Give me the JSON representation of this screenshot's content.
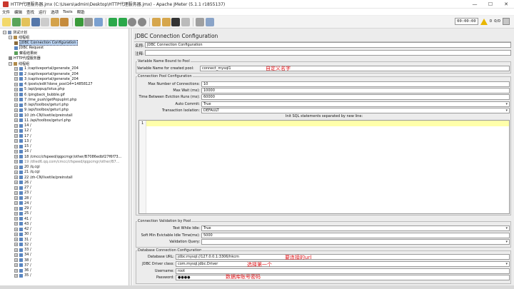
{
  "window": {
    "title": "HTTP代理服务器.jmx (C:\\Users\\admin\\Desktop\\HTTP代理服务器.jmx) - Apache JMeter (5.1.1 r1855137)",
    "min": "—",
    "max": "☐",
    "close": "✕"
  },
  "menu": [
    "文件",
    "编辑",
    "查找",
    "运行",
    "选项",
    "Tools",
    "帮助"
  ],
  "toolbar": {
    "timer": "00:00:00",
    "warnings": "0",
    "threads": "0/0"
  },
  "tree": [
    {
      "label": "测试计划",
      "level": 0,
      "icon": "test-plan-icon",
      "toggle": "−"
    },
    {
      "label": "线程组",
      "level": 1,
      "icon": "thread-group-icon",
      "toggle": "−"
    },
    {
      "label": "JDBC Connection Configuration",
      "level": 2,
      "icon": "config-icon",
      "selected": true
    },
    {
      "label": "JDBC Request",
      "level": 2,
      "icon": "sampler-icon"
    },
    {
      "label": "察看结果树",
      "level": 2,
      "icon": "listener-icon"
    },
    {
      "label": "HTTP代理服务器",
      "level": 1,
      "icon": "proxy-icon"
    },
    {
      "label": "线程组",
      "level": 1,
      "icon": "thread-group-icon",
      "toggle": "−"
    },
    {
      "label": "1 /captiveportal/generate_204",
      "level": 2,
      "icon": "sampler-icon",
      "toggle": "+"
    },
    {
      "label": "2 /captiveportal/generate_204",
      "level": 2,
      "icon": "sampler-icon",
      "toggle": "+"
    },
    {
      "label": "3 /captiveportal/generate_204",
      "level": 2,
      "icon": "sampler-icon",
      "toggle": "+"
    },
    {
      "label": "4 /posts/edit?done_post14=14858127",
      "level": 2,
      "icon": "sampler-icon",
      "toggle": "+"
    },
    {
      "label": "5 /api/popup/lotus.php",
      "level": 2,
      "icon": "sampler-icon",
      "toggle": "+"
    },
    {
      "label": "6 /pingback_bubble.gif",
      "level": 2,
      "icon": "sampler-icon",
      "toggle": "+"
    },
    {
      "label": "7 /ime_push/getPopupInt.php",
      "level": 2,
      "icon": "sampler-icon",
      "toggle": "+"
    },
    {
      "label": "8 /api/toolbox/geturl.php",
      "level": 2,
      "icon": "sampler-icon",
      "toggle": "+"
    },
    {
      "label": "9 /api/toolbox/geturl.php",
      "level": 2,
      "icon": "sampler-icon",
      "toggle": "+"
    },
    {
      "label": "10 /zh-CN/livetile/preinstall",
      "level": 2,
      "icon": "sampler-icon",
      "toggle": "+"
    },
    {
      "label": "11 /api/toolbox/geturl.php",
      "level": 2,
      "icon": "sampler-icon",
      "toggle": "+"
    },
    {
      "label": "14 /",
      "level": 2,
      "icon": "sampler-icon",
      "toggle": "+"
    },
    {
      "label": "12 /",
      "level": 2,
      "icon": "sampler-icon",
      "toggle": "+"
    },
    {
      "label": "17 /",
      "level": 2,
      "icon": "sampler-icon",
      "toggle": "+"
    },
    {
      "label": "13 /",
      "level": 2,
      "icon": "sampler-icon",
      "toggle": "+"
    },
    {
      "label": "15 /",
      "level": 2,
      "icon": "sampler-icon",
      "toggle": "+"
    },
    {
      "label": "16 /",
      "level": 2,
      "icon": "sampler-icon",
      "toggle": "+"
    },
    {
      "label": "18 /cmcc/cfspeed/qqpcmgr/other/B7086edbf27f6f73...",
      "level": 2,
      "icon": "sampler-icon",
      "toggle": "+"
    },
    {
      "label": "19 /dlied6.qq.com/cmcc/cfspeed/qqpcmgr/other/B7...",
      "level": 2,
      "icon": "sampler-icon",
      "toggle": "+",
      "dim": true
    },
    {
      "label": "20 /q.cgi",
      "level": 2,
      "icon": "sampler-icon",
      "toggle": "+"
    },
    {
      "label": "21 /q.cgi",
      "level": 2,
      "icon": "sampler-icon",
      "toggle": "+"
    },
    {
      "label": "22 /zh-CN/livetile/preinstall",
      "level": 2,
      "icon": "sampler-icon",
      "toggle": "+"
    },
    {
      "label": "26 /",
      "level": 2,
      "icon": "sampler-icon",
      "toggle": "+"
    },
    {
      "label": "27 /",
      "level": 2,
      "icon": "sampler-icon",
      "toggle": "+"
    },
    {
      "label": "23 /",
      "level": 2,
      "icon": "sampler-icon",
      "toggle": "+"
    },
    {
      "label": "28 /",
      "level": 2,
      "icon": "sampler-icon",
      "toggle": "+"
    },
    {
      "label": "24 /",
      "level": 2,
      "icon": "sampler-icon",
      "toggle": "+"
    },
    {
      "label": "29 /",
      "level": 2,
      "icon": "sampler-icon",
      "toggle": "+"
    },
    {
      "label": "25 /",
      "level": 2,
      "icon": "sampler-icon",
      "toggle": "+"
    },
    {
      "label": "41 /",
      "level": 2,
      "icon": "sampler-icon",
      "toggle": "+"
    },
    {
      "label": "43 /",
      "level": 2,
      "icon": "sampler-icon",
      "toggle": "+"
    },
    {
      "label": "42 /",
      "level": 2,
      "icon": "sampler-icon",
      "toggle": "+"
    },
    {
      "label": "30 /",
      "level": 2,
      "icon": "sampler-icon",
      "toggle": "+"
    },
    {
      "label": "31 /",
      "level": 2,
      "icon": "sampler-icon",
      "toggle": "+"
    },
    {
      "label": "32 /",
      "level": 2,
      "icon": "sampler-icon",
      "toggle": "+"
    },
    {
      "label": "33 /",
      "level": 2,
      "icon": "sampler-icon",
      "toggle": "+"
    },
    {
      "label": "34 /",
      "level": 2,
      "icon": "sampler-icon",
      "toggle": "+"
    },
    {
      "label": "38 /",
      "level": 2,
      "icon": "sampler-icon",
      "toggle": "+"
    },
    {
      "label": "37 /",
      "level": 2,
      "icon": "sampler-icon",
      "toggle": "+"
    },
    {
      "label": "36 /",
      "level": 2,
      "icon": "sampler-icon",
      "toggle": "+"
    },
    {
      "label": "35 /",
      "level": 2,
      "icon": "sampler-icon",
      "toggle": "+"
    }
  ],
  "panel": {
    "title": "JDBC Connection Configuration",
    "name_label": "名称:",
    "name_value": "JDBC Connection Configuration",
    "comment_label": "注释:",
    "comment_value": "",
    "var_group_title": "Variable Name Bound to Pool",
    "var_label": "Variable Name for created pool:",
    "var_value": "connect_mysql1",
    "var_annotation": "自定义名字",
    "pool_group_title": "Connection Pool Configuration",
    "pool_fields": [
      {
        "label": "Max Number of Connections:",
        "value": "10"
      },
      {
        "label": "Max Wait (ms):",
        "value": "10000"
      },
      {
        "label": "Time Between Eviction Runs (ms):",
        "value": "60000"
      },
      {
        "label": "Auto Commit:",
        "value": "True",
        "combo": true
      },
      {
        "label": "Transaction Isolation:",
        "value": "DEFAULT",
        "combo": true
      }
    ],
    "sql_header": "Init SQL statements separated by new line:",
    "sql_line_no": "1",
    "valid_group_title": "Connection Validation by Pool",
    "valid_fields": [
      {
        "label": "Test While Idle:",
        "value": "True",
        "combo": true
      },
      {
        "label": "Soft Min Evictable Idle Time(ms):",
        "value": "5000"
      },
      {
        "label": "Validation Query:",
        "value": "",
        "combo": true
      }
    ],
    "db_group_title": "Database Connection Configuration",
    "db_fields": [
      {
        "label": "Database URL:",
        "value": "jdbc:mysql://127.0.0.1:3306/hkcm"
      },
      {
        "label": "JDBC Driver class:",
        "value": "com.mysql.jdbc.Driver",
        "combo": true
      },
      {
        "label": "Username:",
        "value": "root"
      },
      {
        "label": "Password:",
        "value": "●●●●"
      }
    ],
    "url_annotation": "要连接的url",
    "driver_annotation": "选择第一个",
    "cred_annotation": "数据库账号密码"
  },
  "colors": {
    "annotation": "#e0161a",
    "selection": "#bcd6f5",
    "sql_highlight": "#ffffaa"
  }
}
